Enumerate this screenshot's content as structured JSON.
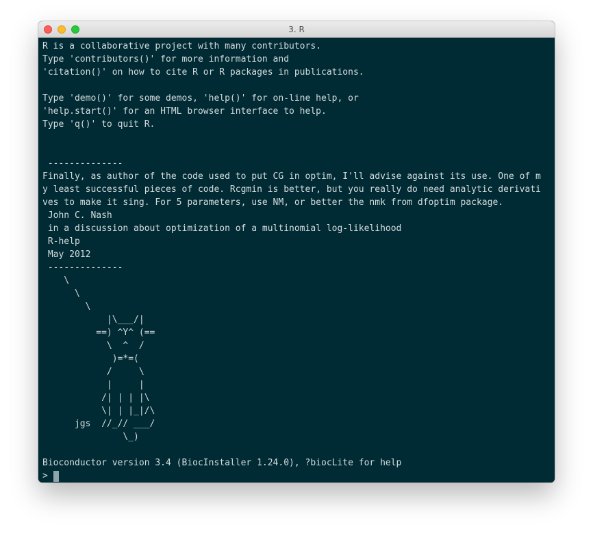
{
  "window": {
    "title": "3. R"
  },
  "terminal": {
    "lines": [
      "R is a collaborative project with many contributors.",
      "Type 'contributors()' for more information and",
      "'citation()' on how to cite R or R packages in publications.",
      "",
      "Type 'demo()' for some demos, 'help()' for on-line help, or",
      "'help.start()' for an HTML browser interface to help.",
      "Type 'q()' to quit R.",
      "",
      "",
      " --------------",
      "Finally, as author of the code used to put CG in optim, I'll advise against its use. One of m",
      "y least successful pieces of code. Rcgmin is better, but you really do need analytic derivati",
      "ves to make it sing. For 5 parameters, use NM, or better the nmk from dfoptim package.",
      " John C. Nash",
      " in a discussion about optimization of a multinomial log-likelihood",
      " R-help",
      " May 2012",
      " --------------",
      "    \\",
      "      \\",
      "        \\",
      "            |\\___/|",
      "          ==) ^Y^ (==",
      "            \\  ^  /",
      "             )=*=(",
      "            /     \\",
      "            |     |",
      "           /| | | |\\",
      "           \\| | |_|/\\",
      "      jgs  //_// ___/",
      "               \\_)",
      "",
      "Bioconductor version 3.4 (BiocInstaller 1.24.0), ?biocLite for help"
    ],
    "prompt": "> "
  },
  "colors": {
    "background": "#002b35",
    "text": "#d5dcdc",
    "cursor": "#8ea5ab"
  }
}
